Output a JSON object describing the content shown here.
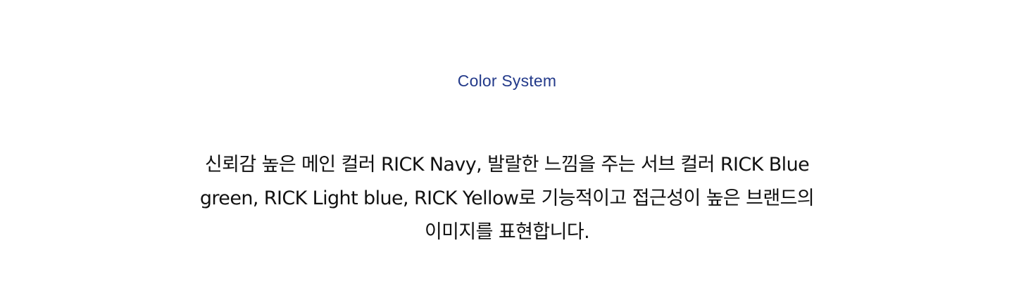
{
  "section": {
    "eyebrow": "Color System",
    "description_lines": [
      "신뢰감 높은 메인 컬러 RICK Navy, 발랄한 느낌을 주는 서브 컬러 RICK Blue",
      "green, RICK Light blue, RICK Yellow로 기능적이고 접근성이 높은 브랜드의",
      "이미지를 표현합니다."
    ]
  },
  "colors": {
    "eyebrow": "#233a8a",
    "text": "#111111",
    "background": "#ffffff"
  }
}
